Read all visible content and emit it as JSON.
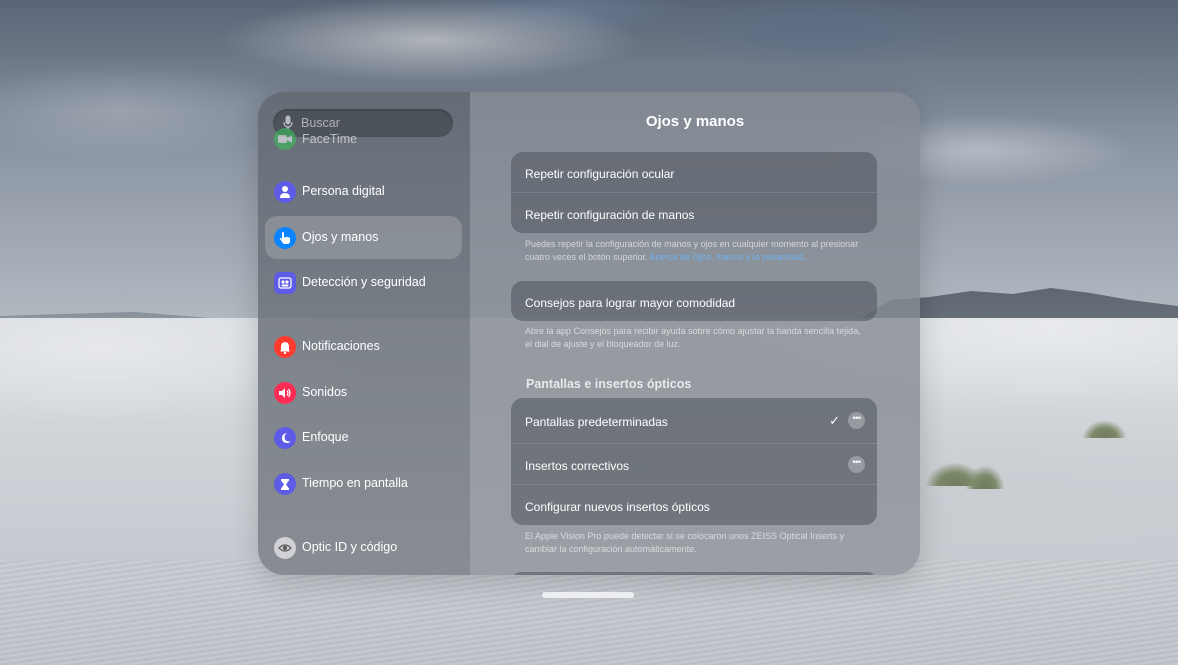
{
  "search": {
    "placeholder": "Buscar"
  },
  "sidebar": {
    "items": [
      {
        "label": "FaceTime",
        "color": "#34c759"
      },
      {
        "label": "Persona digital",
        "color": "#5e5ce6"
      },
      {
        "label": "Ojos y manos",
        "color": "#0a84ff",
        "selected": true
      },
      {
        "label": "Detección y seguridad",
        "color": "#5e5ce6"
      },
      {
        "label": "Notificaciones",
        "color": "#ff3b30"
      },
      {
        "label": "Sonidos",
        "color": "#ff2d55"
      },
      {
        "label": "Enfoque",
        "color": "#5e5ce6"
      },
      {
        "label": "Tiempo en pantalla",
        "color": "#5e5ce6"
      },
      {
        "label": "Optic ID y código",
        "color": "#d1d1d6"
      }
    ]
  },
  "content": {
    "title": "Ojos y manos",
    "group1": {
      "rows": [
        "Repetir configuración ocular",
        "Repetir configuración de manos"
      ],
      "footer": "Puedes repetir la configuración de manos y ojos en cualquier momento al presionar cuatro veces el botón superior.",
      "footer_link": "Acerca de Ojos, manos y la privacidad…"
    },
    "group2": {
      "rows": [
        "Consejos para lograr mayor comodidad"
      ],
      "footer": "Abre la app Consejos para recibir ayuda sobre cómo ajustar la banda sencilla tejida, el dial de ajuste y el bloqueador de luz."
    },
    "section3": {
      "header": "Pantallas e insertos ópticos",
      "rows": [
        "Pantallas predeterminadas",
        "Insertos correctivos",
        "Configurar nuevos insertos ópticos"
      ],
      "checkmark": "✓",
      "more": "•••",
      "footer": "El Apple Vision Pro puede detectar si se colocaron unos ZEISS Optical Inserts y cambiar la configuración automáticamente."
    }
  }
}
